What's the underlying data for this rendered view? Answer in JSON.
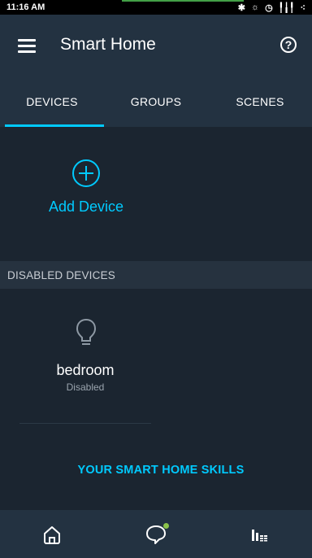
{
  "status_bar": {
    "time": "11:16 AM",
    "icons": [
      "bluetooth-icon",
      "no-sound-icon",
      "alarm-icon",
      "signal-icon",
      "network-icon"
    ]
  },
  "header": {
    "title": "Smart Home",
    "help_symbol": "?"
  },
  "tabs": [
    {
      "label": "DEVICES",
      "active": true
    },
    {
      "label": "GROUPS",
      "active": false
    },
    {
      "label": "SCENES",
      "active": false
    }
  ],
  "add_device": {
    "label": "Add Device"
  },
  "disabled_section": {
    "header": "DISABLED DEVICES"
  },
  "devices": [
    {
      "name": "bedroom",
      "status": "Disabled",
      "icon": "lightbulb-icon"
    }
  ],
  "skills_link": "YOUR SMART HOME SKILLS",
  "bottom_nav": [
    "home-icon",
    "chat-icon",
    "equalizer-icon"
  ],
  "colors": {
    "accent": "#00caff",
    "background": "#1b2530",
    "bar": "#233241",
    "notification": "#8bc34a"
  }
}
